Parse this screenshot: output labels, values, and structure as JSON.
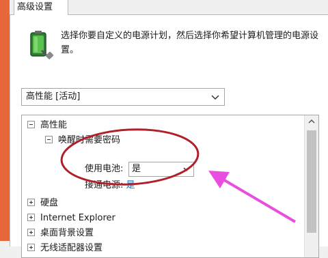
{
  "tab": {
    "label": "高级设置"
  },
  "header": {
    "description": "选择你要自定义的电源计划，然后选择你希望计算机管理的电源设置。"
  },
  "plan_select": {
    "value": "高性能 [活动]"
  },
  "tree": {
    "root_label": "高性能",
    "wake_password_label": "唤醒时需要密码",
    "battery_label": "使用电池:",
    "battery_value": "是",
    "plugged_label": "接通电源:",
    "plugged_value": "是",
    "items": [
      {
        "label": "硬盘"
      },
      {
        "label": "Internet Explorer"
      },
      {
        "label": "桌面背景设置"
      },
      {
        "label": "无线适配器设置"
      }
    ]
  },
  "colors": {
    "left_strip": "#e6673a",
    "annotation_circle": "#b0202a",
    "annotation_arrow": "#e84fe0",
    "link_value": "#1a6fb5"
  },
  "icons": [
    "battery-plug-icon",
    "chevron-down-icon",
    "expand-minus-icon",
    "expand-plus-icon",
    "scroll-up-arrow-icon"
  ]
}
